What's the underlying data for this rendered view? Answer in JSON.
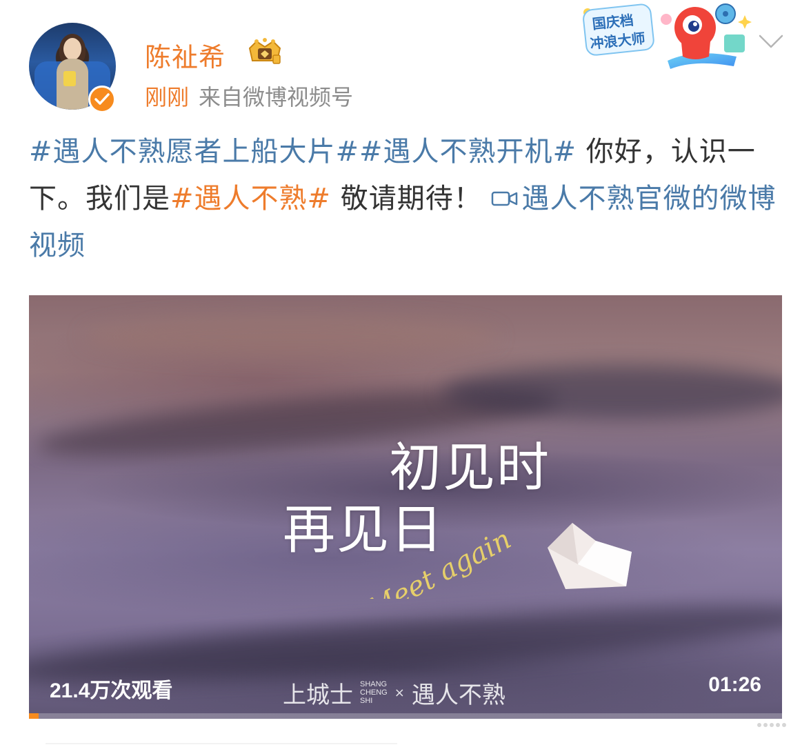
{
  "post": {
    "author": {
      "name": "陈祉希",
      "verified_color": "#f78b1e"
    },
    "time": "刚刚",
    "source": "来自微博视频号",
    "text": {
      "topic1": "#遇人不熟愿者上船大片#",
      "topic2": "#遇人不熟开机#",
      "plain1": " 你好，认识一下。我们是",
      "topic3": "#遇人不熟#",
      "plain2": " 敬请期待！",
      "video_link": "遇人不熟官微的微博视频"
    },
    "video": {
      "title_line1": "初见时",
      "title_line2": "再见日",
      "script_text": "Meet again",
      "view_count": "21.4万次观看",
      "duration": "01:26",
      "watermark_brand": "上城士",
      "watermark_sub": "SHANG\nCHENG\nSHI",
      "watermark_x": "×",
      "watermark_partner": "遇人不熟",
      "progress": 0.013
    }
  },
  "promo_badge": {
    "line1": "国庆档",
    "line2": "冲浪大师"
  },
  "colors": {
    "accent_orange": "#ee7c2c",
    "topic_blue": "#4a7aa8",
    "secondary_gray": "#8c8c8c"
  },
  "icons": [
    "crown-icon",
    "verified-check-icon",
    "chevron-down-icon",
    "video-link-icon",
    "more-dots-icon"
  ]
}
